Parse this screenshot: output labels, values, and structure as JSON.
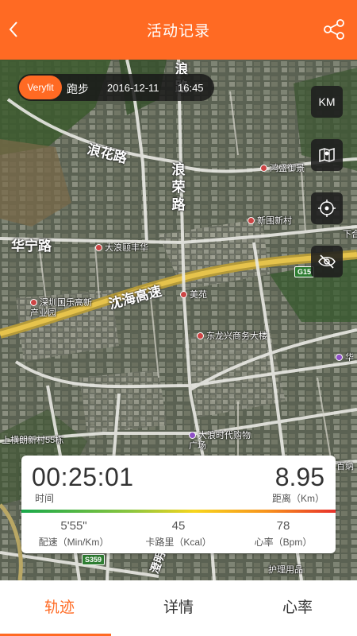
{
  "header": {
    "title": "活动记录",
    "back_icon": "chevron-left-icon",
    "share_icon": "share-icon"
  },
  "activity": {
    "badge": "Veryfit",
    "type": "跑步",
    "date": "2016-12-11",
    "time": "16:45"
  },
  "map_tools": {
    "unit_label": "KM",
    "map_icon": "map-icon",
    "locate_icon": "locate-icon",
    "hide_icon": "eye-slash-icon"
  },
  "map": {
    "roads": {
      "langhua": "浪花路",
      "langrong": "浪荣路",
      "huaning": "华宁路",
      "expressway": "沈海高速",
      "top_road": "浪路",
      "bottom_road": "澄明路"
    },
    "pois": {
      "hongjin": "鸿盛御景",
      "xinwei": "新围新村",
      "dalang_jinghua": "大浪颐丰华",
      "music_park": "深圳国乐高新产业园",
      "meiyuan": "美苑",
      "donglongxing": "东龙兴商务大楼",
      "dalang_times": "大浪时代购物广场",
      "heng_lang": "上横朗新村55栋",
      "xiahe": "下合",
      "hua": "华",
      "baina": "百纳",
      "huli": "护理用品"
    },
    "shields": {
      "g15": "G15",
      "s359": "S359"
    }
  },
  "stats": {
    "duration": "00:25:01",
    "duration_label": "时间",
    "distance": "8.95",
    "distance_label": "距离（Km）",
    "pace": "5'55\"",
    "pace_label": "配速（Min/Km）",
    "calories": "45",
    "calories_label": "卡路里（Kcal）",
    "heart_rate": "78",
    "heart_rate_label": "心率（Bpm）"
  },
  "tabs": [
    "轨迹",
    "详情",
    "心率"
  ],
  "colors": {
    "accent": "#ff6a23"
  }
}
